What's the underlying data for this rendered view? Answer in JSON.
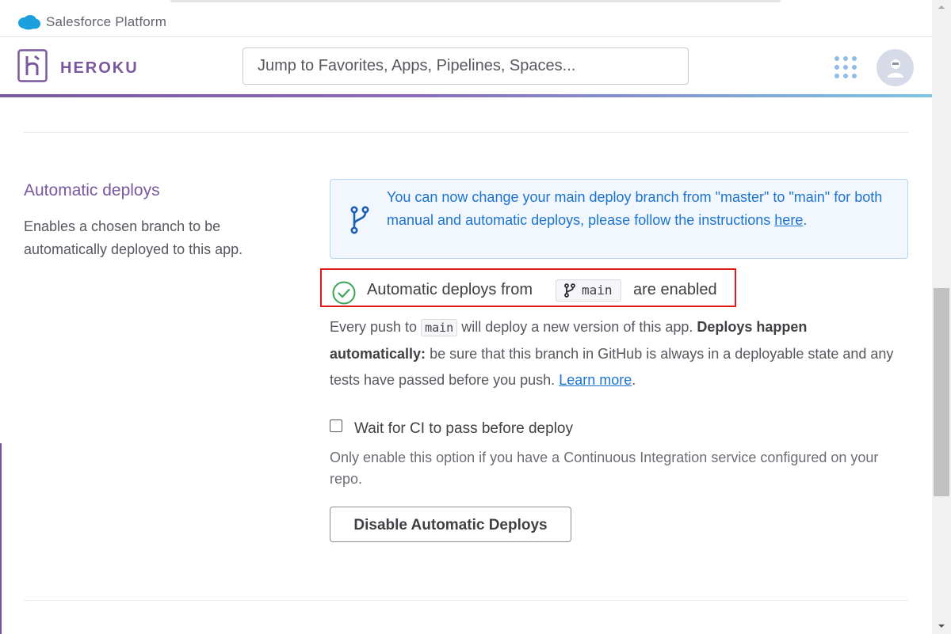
{
  "salesforce_bar": {
    "logo_icon": "salesforce-cloud-icon",
    "title": "Salesforce Platform"
  },
  "header": {
    "brand": "HEROKU",
    "logo_icon": "heroku-logo-icon",
    "search_placeholder": "Jump to Favorites, Apps, Pipelines, Spaces...",
    "apps_icon": "apps-grid-icon",
    "avatar_icon": "user-avatar-icon",
    "gradient_colors": [
      "#79589f",
      "#7cc6e3"
    ]
  },
  "section": {
    "title": "Automatic deploys",
    "description": "Enables a chosen branch to be automatically deployed to this app."
  },
  "info_banner": {
    "icon": "branch-icon",
    "text": "You can now change your main deploy branch from \"master\" to \"main\" for both manual and automatic deploys, please follow the instructions",
    "link_text": "here",
    "text_end": "."
  },
  "status": {
    "icon": "check-circle-icon",
    "prefix": "Automatic deploys from",
    "branch": "main",
    "suffix": "are enabled",
    "highlight_color": "#e0191b"
  },
  "explanation": {
    "part1": "Every push to",
    "branch": "main",
    "part2": "will deploy a new version of this app.",
    "bold": "Deploys happen automatically:",
    "part3": "be sure that this branch in GitHub is always in a deployable state and any tests have passed before you push.",
    "link_text": "Learn more",
    "end": "."
  },
  "ci_option": {
    "label": "Wait for CI to pass before deploy",
    "checked": false,
    "help": "Only enable this option if you have a Continuous Integration service configured on your repo."
  },
  "actions": {
    "disable_label": "Disable Automatic Deploys"
  },
  "colors": {
    "accent": "#79589f",
    "link": "#1a73d0",
    "success": "#3aa655"
  }
}
